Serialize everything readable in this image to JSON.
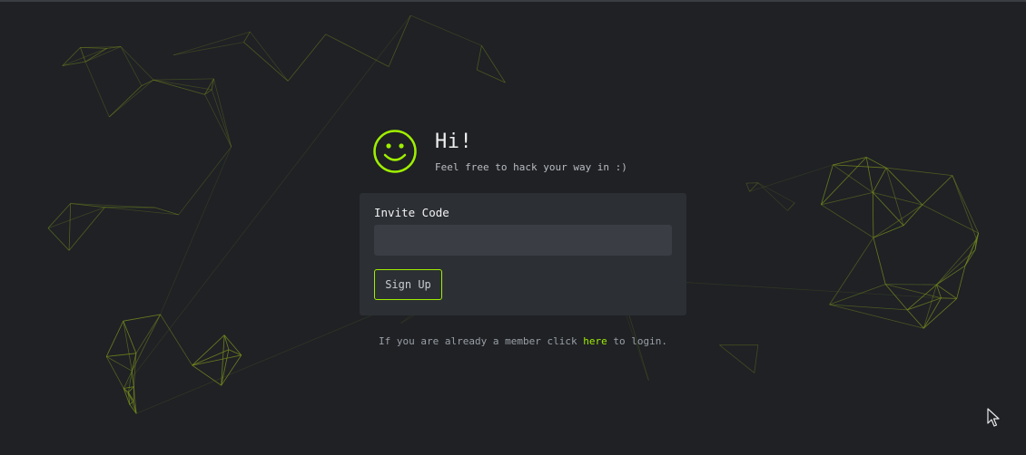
{
  "hero": {
    "icon": "smiley-face-icon",
    "title": "Hi!",
    "subtitle": "Feel free to hack your way in :)"
  },
  "form": {
    "invite_label": "Invite Code",
    "invite_value": "",
    "signup_label": "Sign Up"
  },
  "footer": {
    "prefix": "If you are already a member click",
    "link_text": "here",
    "suffix": "to login."
  },
  "colors": {
    "background": "#1f2125",
    "card": "#2c2f34",
    "input": "#3a3e44",
    "accent": "#9fef00",
    "network_lines": "#7a8f1e"
  }
}
